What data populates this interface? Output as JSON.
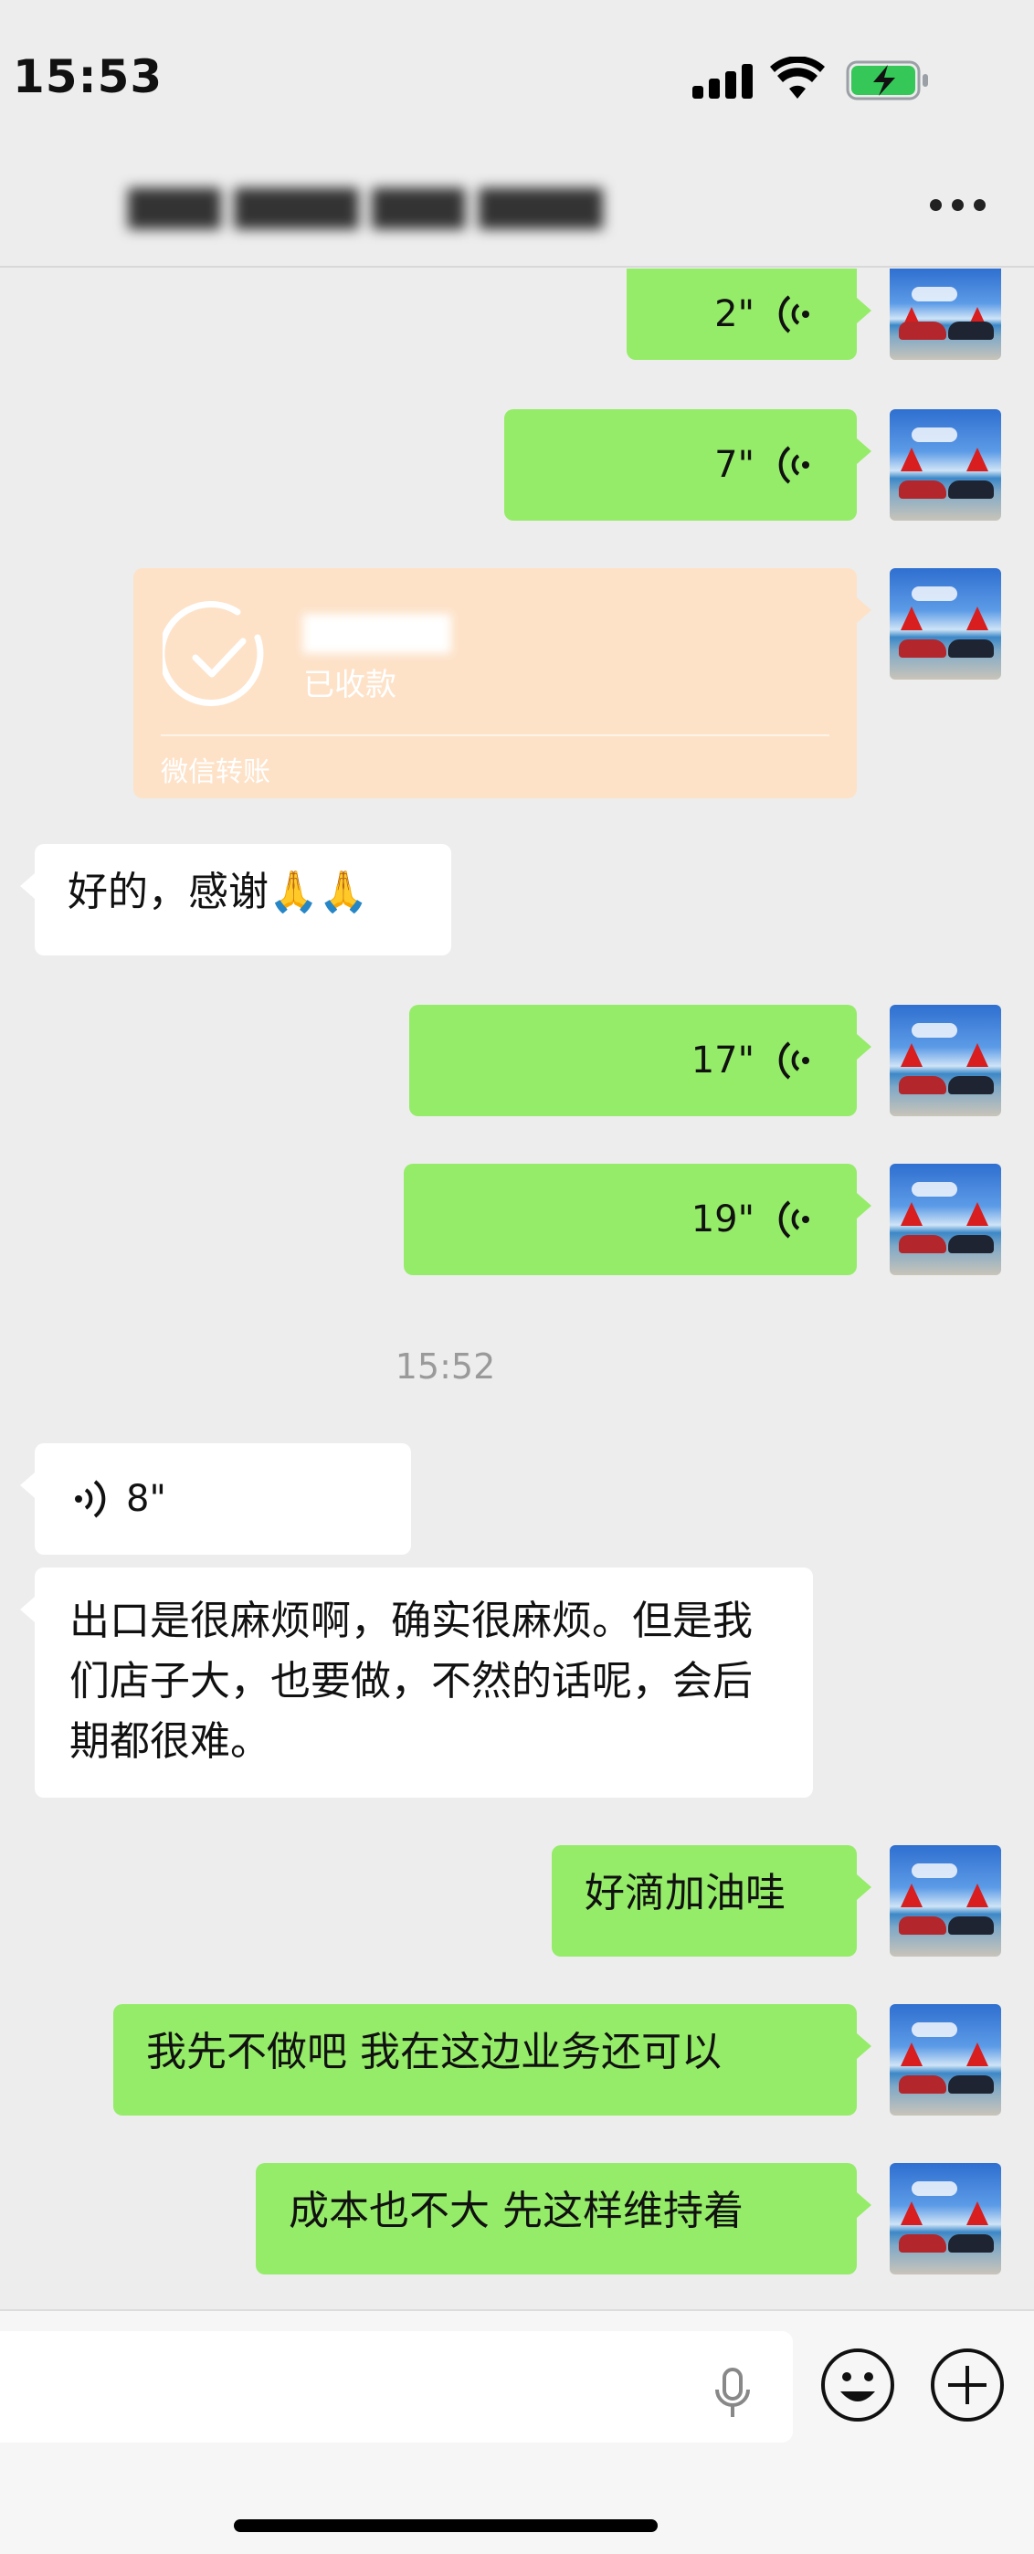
{
  "status_bar": {
    "time": "15:53",
    "battery_charging": true
  },
  "nav": {
    "title": "▇▇▇ ▇▇▇▇ ▇▇▇ ▇▇▇▇",
    "more_icon": "more-icon"
  },
  "messages": {
    "voice_out_1": {
      "duration": "2\""
    },
    "voice_out_2": {
      "duration": "7\""
    },
    "transfer": {
      "amount": "▇▇▇▇▇",
      "status": "已收款",
      "brand": "微信转账"
    },
    "text_in_1": {
      "text": "好的，感谢🙏🙏"
    },
    "voice_out_3": {
      "duration": "17\""
    },
    "voice_out_4": {
      "duration": "19\""
    },
    "timestamp": "15:52",
    "voice_in_1": {
      "duration": "8\""
    },
    "text_in_2": {
      "text": "出口是很麻烦啊，确实很麻烦。但是我们店子大，也要做，不然的话呢，会后期都很难。"
    },
    "text_out_1": {
      "text": "好滴加油哇"
    },
    "text_out_2": {
      "text": "我先不做吧 我在这边业务还可以"
    },
    "text_out_3": {
      "text": "成本也不大 先这样维持着"
    }
  },
  "input_bar": {
    "mic_icon": "mic-icon",
    "emoji_icon": "emoji-icon",
    "plus_icon": "plus-icon"
  },
  "colors": {
    "outgoing_bubble": "#95ec69",
    "incoming_bubble": "#ffffff",
    "transfer_card": "#fde2c8",
    "background": "#ededed"
  }
}
